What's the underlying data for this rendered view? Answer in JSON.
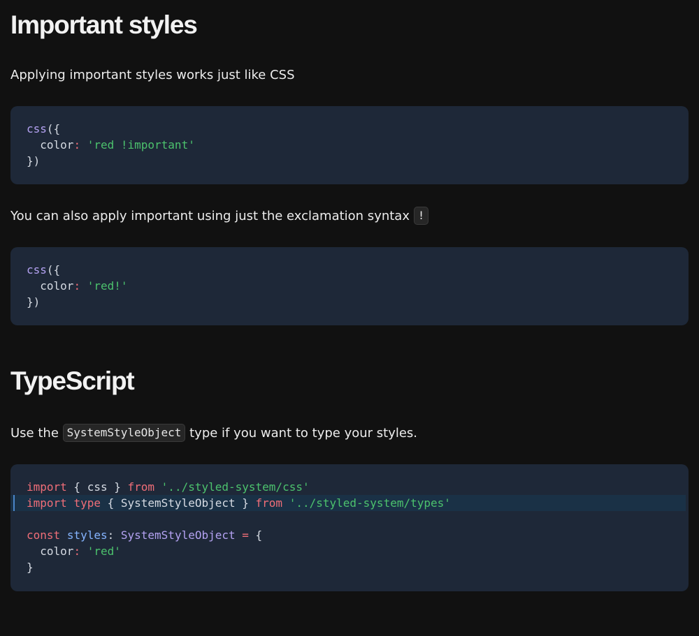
{
  "section_important": {
    "heading": "Important styles",
    "intro": "Applying important styles works just like CSS",
    "code1": {
      "l1_fn": "css",
      "l1_punc": "({",
      "l2_indent": "  ",
      "l2_prop": "color",
      "l2_colon": ": ",
      "l2_str": "'red !important'",
      "l3": "})"
    },
    "exclamation_text": "You can also apply important using just the exclamation syntax",
    "exclamation_code": "!",
    "code2": {
      "l1_fn": "css",
      "l1_punc": "({",
      "l2_indent": "  ",
      "l2_prop": "color",
      "l2_colon": ": ",
      "l2_str": "'red!'",
      "l3": "})"
    }
  },
  "section_typescript": {
    "heading": "TypeScript",
    "intro_before": "Use the",
    "intro_code": "SystemStyleObject",
    "intro_after": "type if you want to type your styles.",
    "code": {
      "l1_import": "import",
      "l1_braces": " { css } ",
      "l1_from": "from",
      "l1_space": " ",
      "l1_path": "'../styled-system/css'",
      "l2_import": "import",
      "l2_sp1": " ",
      "l2_type": "type",
      "l2_braces": " { SystemStyleObject } ",
      "l2_from": "from",
      "l2_space": " ",
      "l2_path": "'../styled-system/types'",
      "l4_const": "const",
      "l4_sp": " ",
      "l4_var": "styles",
      "l4_colon": ": ",
      "l4_type": "SystemStyleObject",
      "l4_sp2": " ",
      "l4_eq": "=",
      "l4_open": " {",
      "l5_indent": "  ",
      "l5_prop": "color",
      "l5_colon": ": ",
      "l5_str": "'red'",
      "l6": "}"
    }
  },
  "colors": {
    "background": "#111111",
    "code_background": "#1e2838",
    "highlight_line": "#1a3146",
    "keyword": "#f06e78",
    "string": "#4cc26d",
    "function": "#b4a2f2",
    "variable": "#85b4ff"
  }
}
